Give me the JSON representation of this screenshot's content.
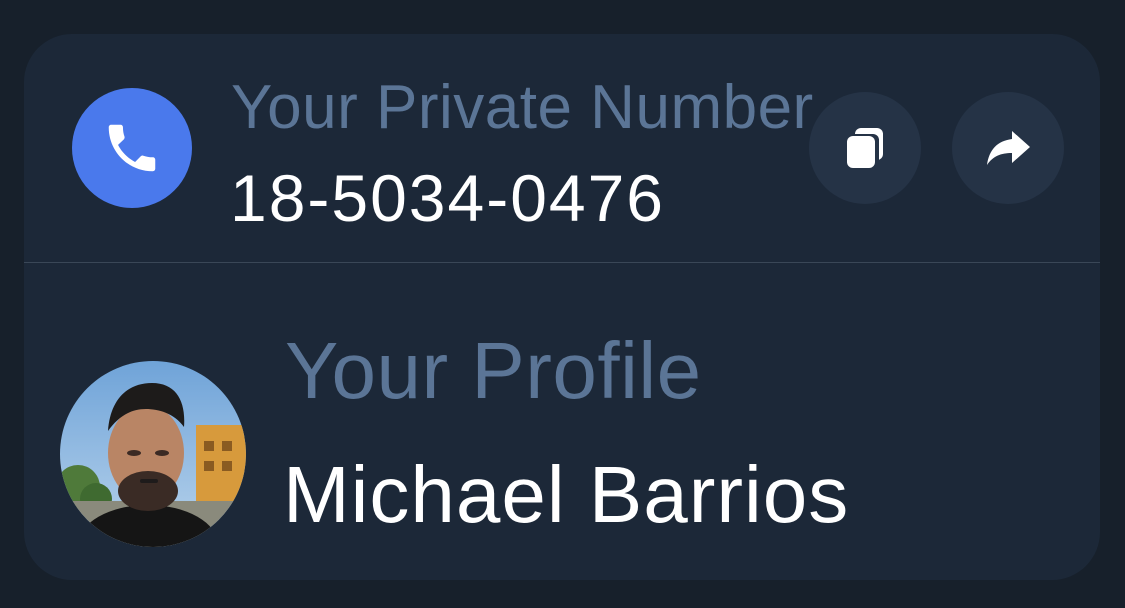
{
  "private_number": {
    "label": "Your Private Number",
    "number": "18-5034-0476",
    "icon": "phone-icon",
    "accent": "#4a79ec",
    "actions": [
      {
        "name": "copy",
        "icon": "copy-icon"
      },
      {
        "name": "share",
        "icon": "share-arrow-icon"
      }
    ]
  },
  "profile": {
    "label": "Your Profile",
    "name": "Michael Barrios",
    "avatar": "profile-photo"
  },
  "colors": {
    "background": "#17202b",
    "card": "#1c2838",
    "label_text": "#5b7596",
    "value_text": "#ffffff",
    "action_button": "#253346"
  }
}
